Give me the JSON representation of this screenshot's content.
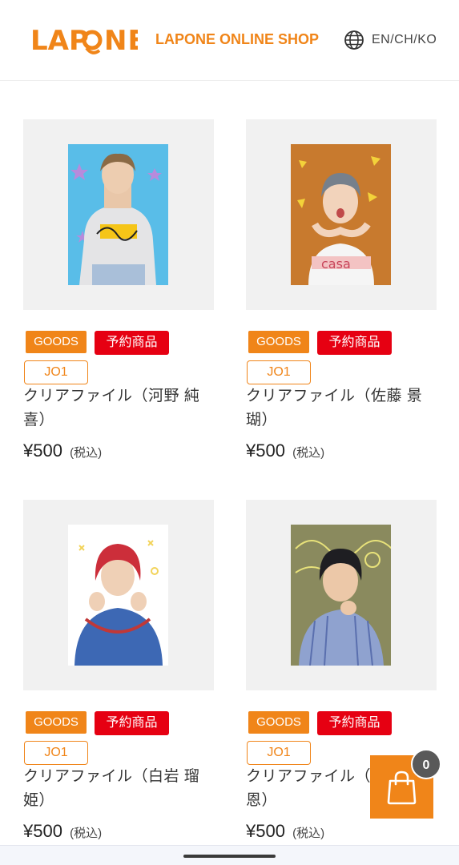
{
  "header": {
    "logo": "LAPONE",
    "shop_title": "LAPONE ONLINE SHOP",
    "lang_icon": "globe-icon",
    "lang_label": "EN/CH/KO"
  },
  "products": [
    {
      "category": "GOODS",
      "status": "予約商品",
      "artist": "JO1",
      "name": "クリアファイル（河野 純喜）",
      "price": "¥500",
      "tax": "(税込)"
    },
    {
      "category": "GOODS",
      "status": "予約商品",
      "artist": "JO1",
      "name": "クリアファイル（佐藤 景瑚）",
      "price": "¥500",
      "tax": "(税込)"
    },
    {
      "category": "GOODS",
      "status": "予約商品",
      "artist": "JO1",
      "name": "クリアファイル（白岩 瑠姫）",
      "price": "¥500",
      "tax": "(税込)"
    },
    {
      "category": "GOODS",
      "status": "予約商品",
      "artist": "JO1",
      "name": "クリアファイル（",
      "name_line2": "恩）",
      "price": "¥500",
      "tax": "(税込)"
    }
  ],
  "cart": {
    "icon": "shopping-bag-icon",
    "count": "0"
  },
  "colors": {
    "brand": "#f08519",
    "preorder": "#e60012",
    "badge": "#595959"
  }
}
